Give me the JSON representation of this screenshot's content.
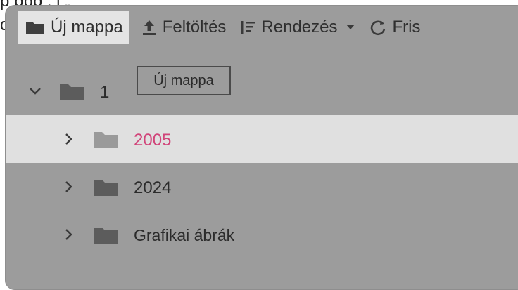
{
  "background": {
    "line1": "p                                                                      ppp                              ,       j                 „ ",
    "line2": "d"
  },
  "toolbar": {
    "new_folder_label": "Új mappa",
    "upload_label": "Feltöltés",
    "sort_label": "Rendezés",
    "refresh_label": "Fris"
  },
  "tooltip": {
    "text": "Új mappa"
  },
  "tree": {
    "root": {
      "label": "1",
      "expanded": true
    },
    "children": [
      {
        "label": "2005",
        "selected": true
      },
      {
        "label": "2024",
        "selected": false
      },
      {
        "label": "Grafikai ábrák",
        "selected": false
      }
    ]
  },
  "colors": {
    "panel": "#9c9c9c",
    "selected_row": "#e0e0e0",
    "selected_label": "#d1457a",
    "folder": "#5c5c5c"
  }
}
